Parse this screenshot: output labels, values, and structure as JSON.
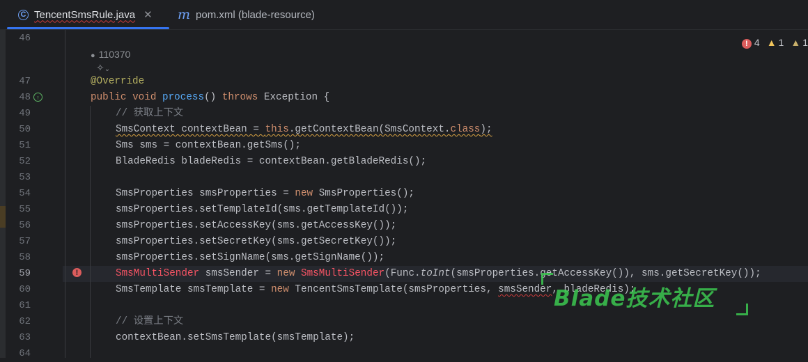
{
  "tabs": [
    {
      "label": "TencentSmsRule.java",
      "icon": "class-icon",
      "active": true
    },
    {
      "label": "pom.xml (blade-resource)",
      "icon": "maven-icon",
      "active": false
    }
  ],
  "inspection": {
    "errors": "4",
    "warnings": "1",
    "weak_warnings": "1"
  },
  "author": {
    "name": "110370"
  },
  "line_numbers": [
    "46",
    "47",
    "48",
    "49",
    "50",
    "51",
    "52",
    "53",
    "54",
    "55",
    "56",
    "57",
    "58",
    "59",
    "60",
    "61",
    "62",
    "63",
    "64"
  ],
  "code": {
    "l47": "@Override",
    "l48_kw1": "public",
    "l48_kw2": "void",
    "l48_fn": "process",
    "l48_rest1": "() ",
    "l48_kw3": "throws",
    "l48_rest2": " Exception {",
    "l49": "// 获取上下文",
    "l50_a": "SmsContext contextBean = ",
    "l50_kw": "this",
    "l50_b": ".getContextBean(SmsContext.",
    "l50_kw2": "class",
    "l50_c": ");",
    "l51": "Sms sms = contextBean.getSms();",
    "l52": "BladeRedis bladeRedis = contextBean.getBladeRedis();",
    "l54_a": "SmsProperties smsProperties = ",
    "l54_kw": "new",
    "l54_b": " SmsProperties();",
    "l55": "smsProperties.setTemplateId(sms.getTemplateId());",
    "l56": "smsProperties.setAccessKey(sms.getAccessKey());",
    "l57": "smsProperties.setSecretKey(sms.getSecretKey());",
    "l58": "smsProperties.setSignName(sms.getSignName());",
    "l59_red1": "SmsMultiSender",
    "l59_a": " smsSender = ",
    "l59_kw": "new",
    "l59_red2": " SmsMultiSender",
    "l59_b": "(Func.",
    "l59_it": "toInt",
    "l59_c": "(smsProperties.getAccessKey()), sms.getSecretKey());",
    "l60_a": "SmsTemplate smsTemplate = ",
    "l60_kw": "new",
    "l60_b": " TencentSmsTemplate(smsProperties, ",
    "l60_w": "smsSender",
    "l60_c": ", bladeRedis);",
    "l62": "// 设置上下文",
    "l63": "contextBean.setSmsTemplate(smsTemplate);"
  },
  "watermark": {
    "text": "Blade技术社区"
  },
  "colors": {
    "accent": "#3574f0",
    "keyword": "#cf8e6d",
    "function": "#56a8f5",
    "annotation": "#b3ae60",
    "error": "#f75464"
  }
}
